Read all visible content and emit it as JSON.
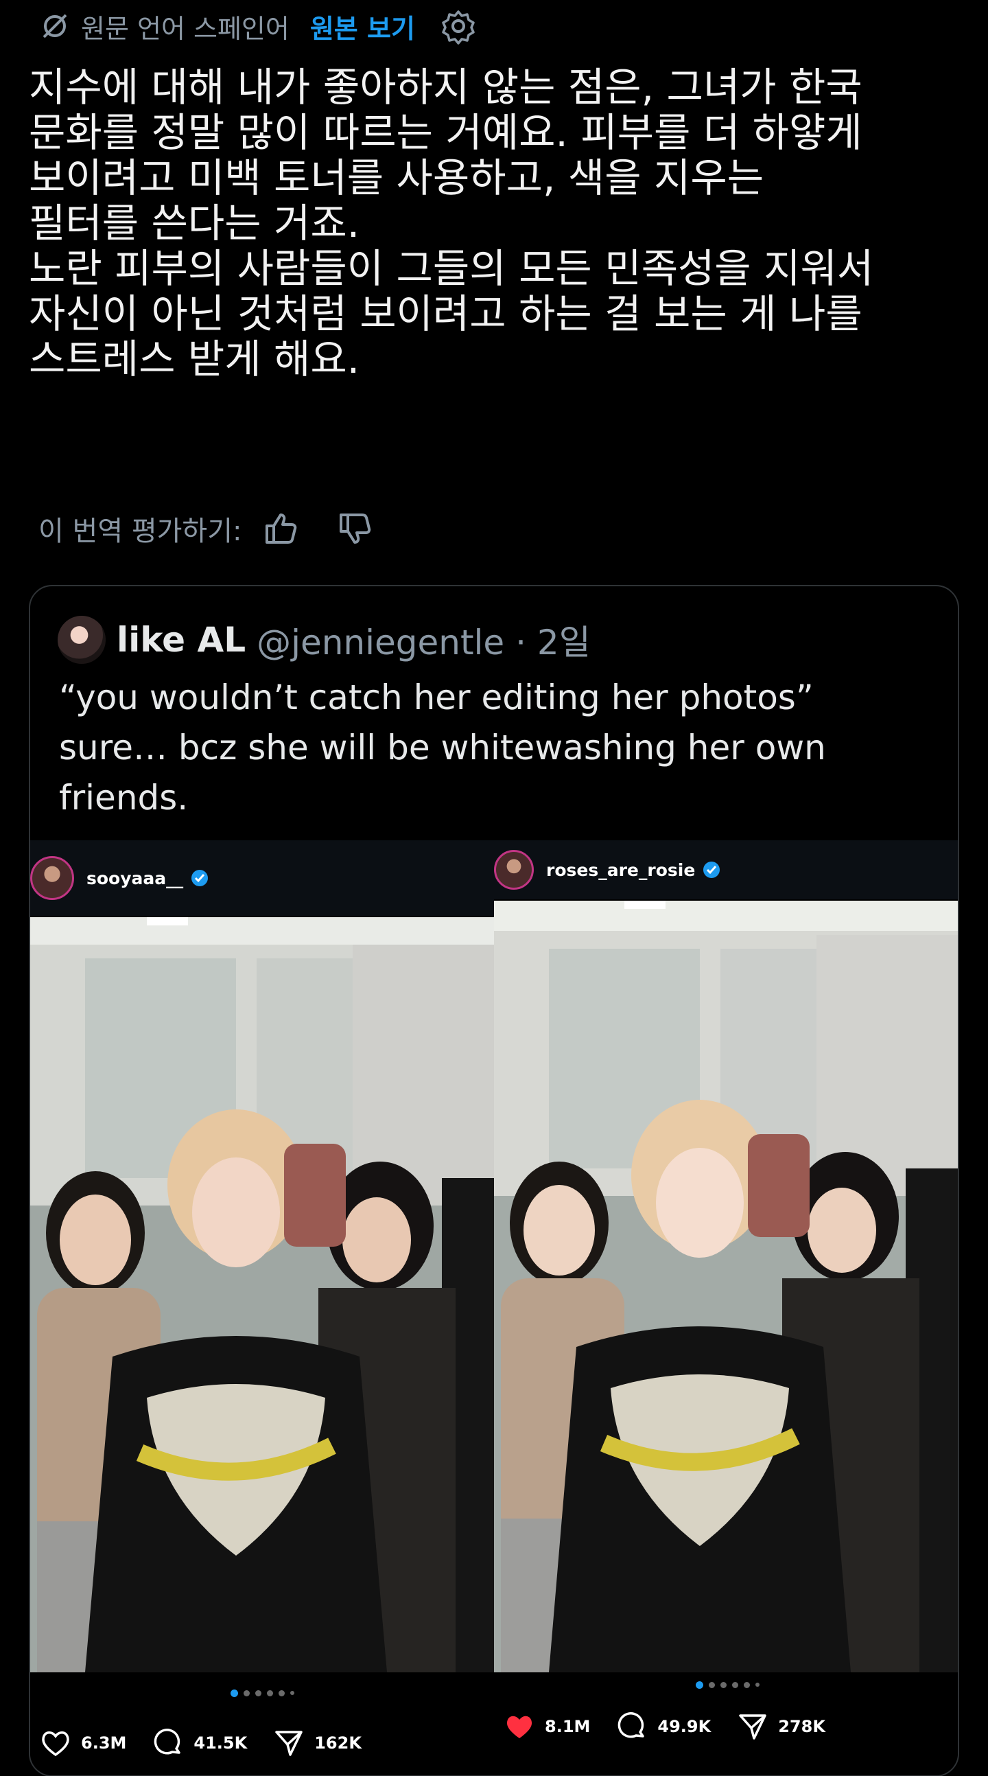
{
  "translation_bar": {
    "label": "원문 언어 스페인어",
    "show_original": "원본 보기"
  },
  "post": {
    "text": "지수에 대해 내가 좋아하지 않는 점은, 그녀가 한국\n문화를 정말 많이 따르는 거예요. 피부를 더 하얗게\n보이려고 미백 토너를 사용하고, 색을 지우는\n필터를 쓴다는 거죠.\n노란 피부의 사람들이 그들의 모든 민족성을 지워서\n자신이 아닌 것처럼 보이려고 하는 걸 보는 게 나를\n스트레스 받게 해요."
  },
  "rating": {
    "label": "이 번역 평가하기:"
  },
  "quote": {
    "name": "like AL",
    "handle": "@jenniegentle · 2일",
    "text": "“you wouldn’t catch her editing her photos”\nsure… bcz she will be whitewashing her own\nfriends.",
    "left": {
      "username": "sooyaaa__",
      "likes": "6.3M",
      "comments": "41.5K",
      "shares": "162K",
      "like_color": "#ffffff"
    },
    "right": {
      "username": "roses_are_rosie",
      "likes": "8.1M",
      "comments": "49.9K",
      "shares": "278K",
      "like_color": "#ff3040"
    }
  },
  "colors": {
    "accent": "#1d9bf0",
    "muted": "#8b98a5",
    "border": "#2f3336",
    "liked": "#ff3040"
  }
}
